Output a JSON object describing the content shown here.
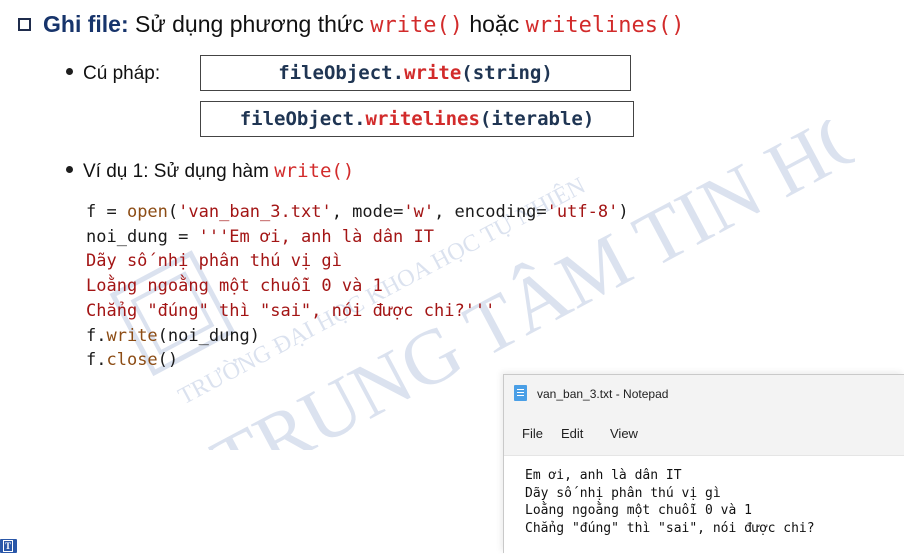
{
  "heading": {
    "bold_label": "Ghi file:",
    "text": "Sử dụng phương thức",
    "method_1": "write()",
    "connector": "hoặc",
    "method_2": "writelines()"
  },
  "syntax": {
    "label": "Cú pháp:",
    "line_1": {
      "object": "fileObject.",
      "method": "write",
      "args": "(string)"
    },
    "line_2": {
      "object": "fileObject.",
      "method": "writelines",
      "args": "(iterable)"
    }
  },
  "example": {
    "label": "Ví dụ 1: Sử dụng hàm",
    "method": "write()"
  },
  "code": {
    "line_1": {
      "var": "f = ",
      "fn": "open",
      "open_paren": "(",
      "arg_1": "'van_ban_3.txt'",
      "sep_1": ", mode=",
      "arg_2": "'w'",
      "sep_2": ", encoding=",
      "arg_3": "'utf-8'",
      "close_paren": ")"
    },
    "line_2": {
      "var": "noi_dung = ",
      "str": "'''Em ơi, anh là dân IT"
    },
    "line_3": "Dãy số nhị phân thú vị gì",
    "line_4": "Loằng ngoằng một chuỗi 0 và 1",
    "line_5": "Chẳng \"đúng\" thì \"sai\", nói được chi?'''",
    "line_6": {
      "obj": "f.",
      "fn": "write",
      "args": "(noi_dung)"
    },
    "line_7": {
      "obj": "f.",
      "fn": "close",
      "args": "()"
    }
  },
  "notepad": {
    "title": "van_ban_3.txt - Notepad",
    "menu": {
      "file": "File",
      "edit": "Edit",
      "view": "View"
    },
    "lines": [
      "Em ơi, anh là dân IT",
      "Dãy số nhị phân thú vị gì",
      "Loằng ngoằng một chuỗi 0 và 1",
      "Chẳng \"đúng\" thì \"sai\", nói được chi?"
    ]
  },
  "watermark": {
    "line_1": "TRUNG TÂM TIN HỌC",
    "line_2": "TRƯỜNG ĐẠI HỌC KHOA HỌC TỰ NHIÊN"
  },
  "corner_logo": {
    "letter": "T"
  },
  "colors": {
    "heading_blue": "#17346b",
    "code_red": "#d22b2b",
    "string_color": "#a31515",
    "function_color": "#8c4c14",
    "watermark_blue": "#4a6fb3"
  }
}
